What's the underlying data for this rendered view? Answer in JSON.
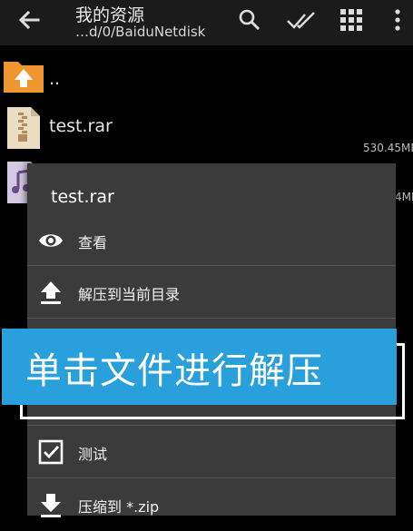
{
  "toolbar": {
    "title": "我的资源",
    "path": "…d/0/BaiduNetdisk"
  },
  "files": [
    {
      "name": "..",
      "size": ""
    },
    {
      "name": "test.rar",
      "size": "530.45MB"
    },
    {
      "name": "",
      "size": "4MB"
    }
  ],
  "dialog": {
    "title": "test.rar",
    "items": [
      {
        "label": "查看",
        "icon": "eye-icon"
      },
      {
        "label": "解压到当前目录",
        "icon": "upload-icon"
      },
      {
        "label": "",
        "icon": "hidden"
      },
      {
        "label": "测试",
        "icon": "checkbox-icon"
      },
      {
        "label": "压缩到 *.zip",
        "icon": "download-icon"
      }
    ]
  },
  "overlay": {
    "caption": "单击文件进行解压"
  },
  "colors": {
    "toolbar_bg": "#1b1b1b",
    "dialog_bg": "#3b3b3b",
    "banner_bg": "#29a0dc",
    "folder_orange": "#f0962f"
  }
}
